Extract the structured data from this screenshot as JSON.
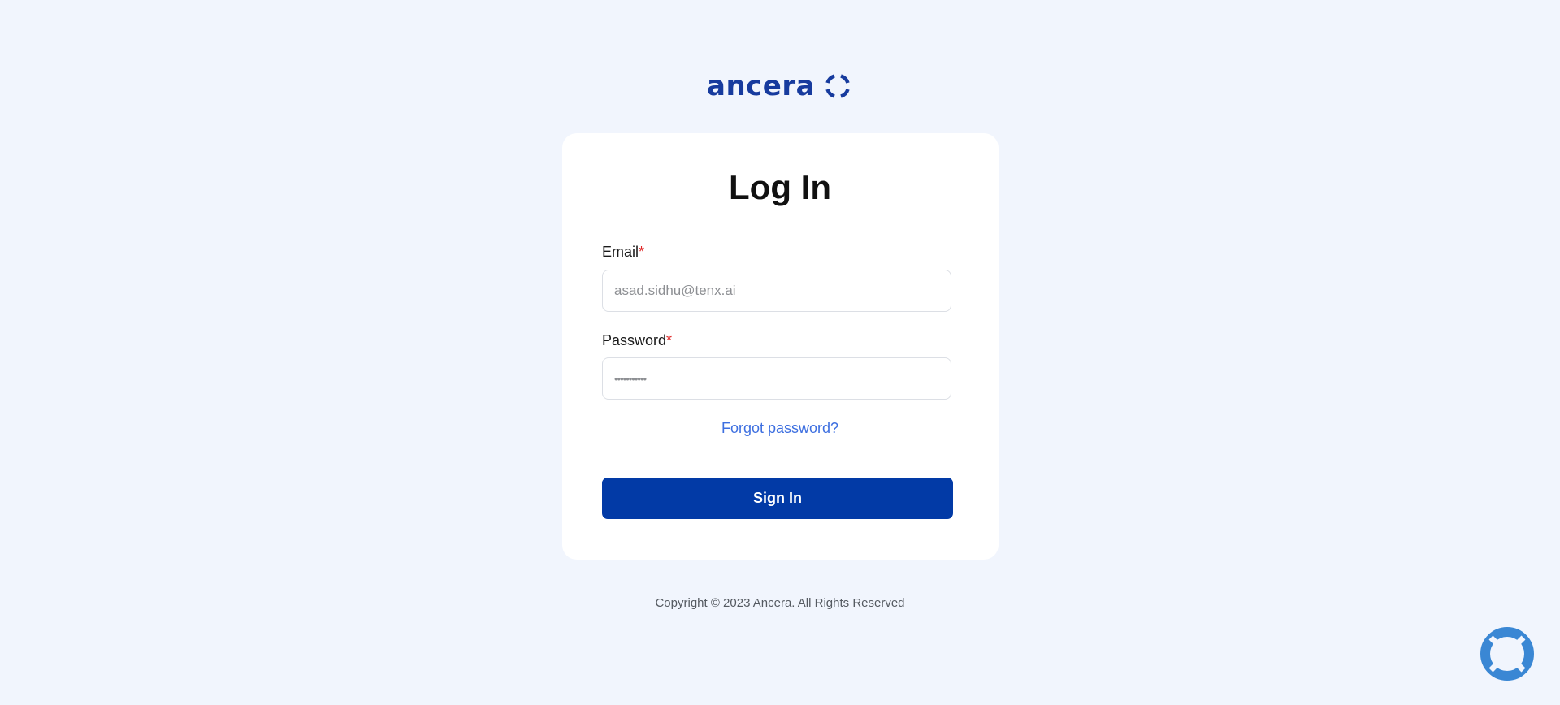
{
  "brand": {
    "name": "ancera",
    "color": "#173b9e"
  },
  "login": {
    "title": "Log In",
    "email_label": "Email",
    "email_value": "asad.sidhu@tenx.ai",
    "password_label": "Password",
    "password_value": "***********",
    "required_mark": "*",
    "forgot_label": "Forgot password?",
    "signin_label": "Sign In"
  },
  "footer": {
    "copyright": "Copyright © 2023 Ancera. All Rights Reserved"
  },
  "help_widget": {
    "icon": "lifebuoy-icon",
    "color": "#3a87d4"
  },
  "colors": {
    "background": "#f1f5fd",
    "primary_button": "#023aa6",
    "link": "#3d6fe0",
    "required": "#e02424"
  }
}
